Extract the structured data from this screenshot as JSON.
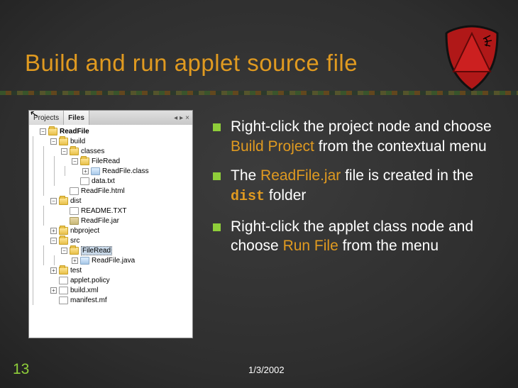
{
  "title": "Build and run applet source file",
  "slide_number": "13",
  "date": "1/3/2002",
  "tabs": {
    "projects": "Projects",
    "files": "Files"
  },
  "bullets": [
    {
      "pre": "Right-click the project node and choose ",
      "hl": "Build Project",
      "post": " from the contextual menu",
      "hlClass": "hl-orange"
    },
    {
      "pre": "The ",
      "hl": "ReadFile.jar",
      "mid": " file is created in the ",
      "hl2": "dist",
      "post": " folder"
    },
    {
      "pre": "Right-click the applet class node and choose ",
      "hl": "Run File",
      "post": " from the menu",
      "hlClass": "hl-orange"
    }
  ],
  "tree": {
    "root": "ReadFile",
    "build": "build",
    "classes": "classes",
    "fileread_pkg": "FileRead",
    "readfile_class": "ReadFile.class",
    "data_txt": "data.txt",
    "readfile_html": "ReadFile.html",
    "dist": "dist",
    "readme": "README.TXT",
    "readfile_jar": "ReadFile.jar",
    "nbproject": "nbproject",
    "src": "src",
    "fileread_src": "FileRead",
    "readfile_java": "ReadFile.java",
    "test": "test",
    "applet_policy": "applet.policy",
    "build_xml": "build.xml",
    "manifest": "manifest.mf"
  }
}
